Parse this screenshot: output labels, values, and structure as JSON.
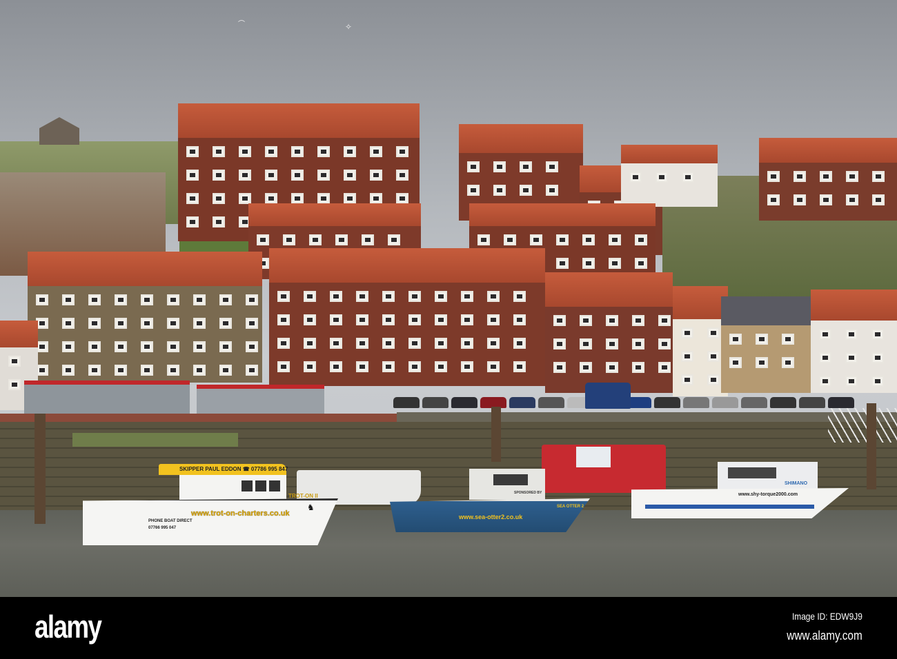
{
  "watermark": {
    "logo": "alamy",
    "image_id": "Image ID: EDW9J9",
    "url": "www.alamy.com"
  },
  "boats": {
    "trot_on": {
      "cabin_sign": "SKIPPER  PAUL EDDON  ☎ 07786 995 847",
      "name": "TROT-ON II",
      "website": "www.trot-on-charters.co.uk",
      "phone_label": "PHONE BOAT DIRECT",
      "phone": "07766 995 047"
    },
    "sea_otter": {
      "name": "SEA OTTER 2",
      "website": "www.sea-otter2.co.uk",
      "sponsor": "SPONSORED BY"
    },
    "shy_torque": {
      "brand": "SHIMANO",
      "website": "www.shy-torque2000.com"
    }
  },
  "colors": {
    "brick": "#7e3a2a",
    "roof": "#c65c3c",
    "water": "#64665f",
    "sky": "#b4b8bd"
  }
}
